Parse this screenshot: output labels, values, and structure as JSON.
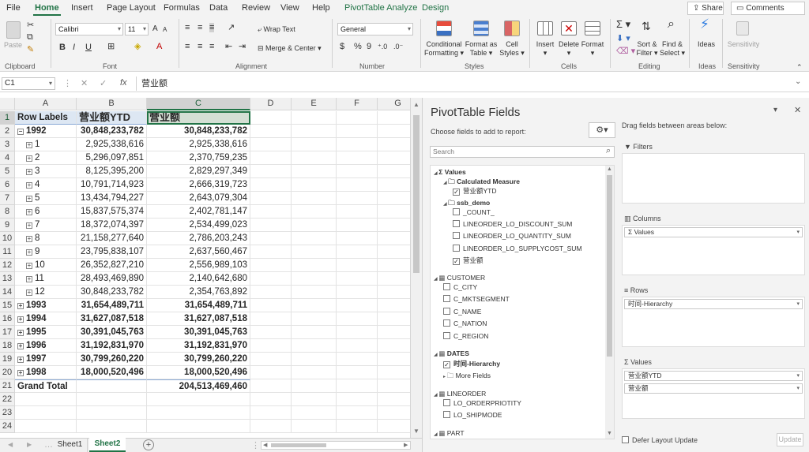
{
  "ribbon_tabs": [
    "File",
    "Home",
    "Insert",
    "Page Layout",
    "Formulas",
    "Data",
    "Review",
    "View",
    "Help",
    "PivotTable Analyze",
    "Design"
  ],
  "share_label": "Share",
  "comments_label": "Comments",
  "clipboard": {
    "paste": "Paste",
    "group": "Clipboard"
  },
  "font": {
    "name": "Calibri",
    "size": "11",
    "group": "Font",
    "bold": "B",
    "italic": "I",
    "underline": "U"
  },
  "alignment": {
    "wrap": "Wrap Text",
    "merge": "Merge & Center",
    "group": "Alignment"
  },
  "number": {
    "format": "General",
    "group": "Number",
    "currency": "$",
    "percent": "%",
    "comma": "9"
  },
  "styles": {
    "conditional": "Conditional",
    "conditional2": "Formatting",
    "format_table": "Format as",
    "format_table2": "Table",
    "cell_styles": "Cell",
    "cell_styles2": "Styles",
    "group": "Styles"
  },
  "cells": {
    "insert": "Insert",
    "delete": "Delete",
    "format": "Format",
    "group": "Cells"
  },
  "editing": {
    "sort": "Sort &",
    "sort2": "Filter",
    "find": "Find &",
    "find2": "Select",
    "group": "Editing"
  },
  "ideas": {
    "label": "Ideas",
    "group": "Ideas"
  },
  "sensitivity": {
    "label": "Sensitivity",
    "group": "Sensitivity"
  },
  "formula_bar": {
    "name_box": "C1",
    "fx": "fx",
    "value": "营业额"
  },
  "columns": [
    "A",
    "B",
    "C",
    "D",
    "E",
    "F",
    "G"
  ],
  "rows": [
    {
      "n": "1",
      "a": "Row Labels",
      "b": "营业额YTD",
      "c": "营业额",
      "type": "header"
    },
    {
      "n": "2",
      "a": "1992",
      "b": "30,848,233,782",
      "c": "30,848,233,782",
      "type": "year_open"
    },
    {
      "n": "3",
      "a": "1",
      "b": "2,925,338,616",
      "c": "2,925,338,616",
      "type": "month"
    },
    {
      "n": "4",
      "a": "2",
      "b": "5,296,097,851",
      "c": "2,370,759,235",
      "type": "month"
    },
    {
      "n": "5",
      "a": "3",
      "b": "8,125,395,200",
      "c": "2,829,297,349",
      "type": "month"
    },
    {
      "n": "6",
      "a": "4",
      "b": "10,791,714,923",
      "c": "2,666,319,723",
      "type": "month"
    },
    {
      "n": "7",
      "a": "5",
      "b": "13,434,794,227",
      "c": "2,643,079,304",
      "type": "month"
    },
    {
      "n": "8",
      "a": "6",
      "b": "15,837,575,374",
      "c": "2,402,781,147",
      "type": "month"
    },
    {
      "n": "9",
      "a": "7",
      "b": "18,372,074,397",
      "c": "2,534,499,023",
      "type": "month"
    },
    {
      "n": "10",
      "a": "8",
      "b": "21,158,277,640",
      "c": "2,786,203,243",
      "type": "month"
    },
    {
      "n": "11",
      "a": "9",
      "b": "23,795,838,107",
      "c": "2,637,560,467",
      "type": "month"
    },
    {
      "n": "12",
      "a": "10",
      "b": "26,352,827,210",
      "c": "2,556,989,103",
      "type": "month"
    },
    {
      "n": "13",
      "a": "11",
      "b": "28,493,469,890",
      "c": "2,140,642,680",
      "type": "month"
    },
    {
      "n": "14",
      "a": "12",
      "b": "30,848,233,782",
      "c": "2,354,763,892",
      "type": "month"
    },
    {
      "n": "15",
      "a": "1993",
      "b": "31,654,489,711",
      "c": "31,654,489,711",
      "type": "year"
    },
    {
      "n": "16",
      "a": "1994",
      "b": "31,627,087,518",
      "c": "31,627,087,518",
      "type": "year"
    },
    {
      "n": "17",
      "a": "1995",
      "b": "30,391,045,763",
      "c": "30,391,045,763",
      "type": "year"
    },
    {
      "n": "18",
      "a": "1996",
      "b": "31,192,831,970",
      "c": "31,192,831,970",
      "type": "year"
    },
    {
      "n": "19",
      "a": "1997",
      "b": "30,799,260,220",
      "c": "30,799,260,220",
      "type": "year"
    },
    {
      "n": "20",
      "a": "1998",
      "b": "18,000,520,496",
      "c": "18,000,520,496",
      "type": "year"
    },
    {
      "n": "21",
      "a": "Grand Total",
      "b": "",
      "c": "204,513,469,460",
      "type": "total"
    },
    {
      "n": "22",
      "a": "",
      "b": "",
      "c": "",
      "type": "empty"
    },
    {
      "n": "23",
      "a": "",
      "b": "",
      "c": "",
      "type": "empty"
    },
    {
      "n": "24",
      "a": "",
      "b": "",
      "c": "",
      "type": "empty"
    }
  ],
  "sheets": [
    "Sheet1",
    "Sheet2"
  ],
  "active_sheet": "Sheet2",
  "pane": {
    "title": "PivotTable Fields",
    "choose": "Choose fields to add to report:",
    "search": "Search",
    "drag": "Drag fields between areas below:",
    "filters": "Filters",
    "columns": "Columns",
    "rows": "Rows",
    "values": "Values",
    "columns_chip": "Σ Values",
    "rows_chip": "时间-Hierarchy",
    "values_chips": [
      "营业额YTD",
      "营业额"
    ],
    "defer": "Defer Layout Update",
    "update": "Update"
  },
  "field_tree": [
    {
      "label": "Σ Values",
      "indent": 0,
      "kind": "group",
      "bold": true
    },
    {
      "label": "Calculated Measure",
      "indent": 1,
      "kind": "folder",
      "bold": true
    },
    {
      "label": "营业额YTD",
      "indent": 2,
      "kind": "check",
      "checked": true
    },
    {
      "label": "ssb_demo",
      "indent": 1,
      "kind": "folder",
      "bold": true
    },
    {
      "label": "_COUNT_",
      "indent": 2,
      "kind": "check",
      "checked": false
    },
    {
      "label": "LINEORDER_LO_DISCOUNT_SUM",
      "indent": 2,
      "kind": "check",
      "checked": false
    },
    {
      "label": "LINEORDER_LO_QUANTITY_SUM",
      "indent": 2,
      "kind": "check",
      "checked": false
    },
    {
      "label": "LINEORDER_LO_SUPPLYCOST_SUM",
      "indent": 2,
      "kind": "check",
      "checked": false
    },
    {
      "label": "营业额",
      "indent": 2,
      "kind": "check",
      "checked": true
    },
    {
      "label": "CUSTOMER",
      "indent": 0,
      "kind": "table",
      "bold": false
    },
    {
      "label": "C_CITY",
      "indent": 1,
      "kind": "check",
      "checked": false
    },
    {
      "label": "C_MKTSEGMENT",
      "indent": 1,
      "kind": "check",
      "checked": false
    },
    {
      "label": "C_NAME",
      "indent": 1,
      "kind": "check",
      "checked": false
    },
    {
      "label": "C_NATION",
      "indent": 1,
      "kind": "check",
      "checked": false
    },
    {
      "label": "C_REGION",
      "indent": 1,
      "kind": "check",
      "checked": false
    },
    {
      "label": "DATES",
      "indent": 0,
      "kind": "table",
      "bold": true
    },
    {
      "label": "时间-Hierarchy",
      "indent": 1,
      "kind": "check",
      "checked": true,
      "bold": true
    },
    {
      "label": "More Fields",
      "indent": 1,
      "kind": "folder",
      "bold": false
    },
    {
      "label": "LINEORDER",
      "indent": 0,
      "kind": "table",
      "bold": false
    },
    {
      "label": "LO_ORDERPRIOTITY",
      "indent": 1,
      "kind": "check",
      "checked": false
    },
    {
      "label": "LO_SHIPMODE",
      "indent": 1,
      "kind": "check",
      "checked": false
    },
    {
      "label": "PART",
      "indent": 0,
      "kind": "table",
      "bold": false
    }
  ],
  "colors": {
    "accent": "#217346",
    "grid_line": "#e3e3e3",
    "header_bg": "#f0f0f0",
    "pane_bg": "#f3f3f3"
  }
}
